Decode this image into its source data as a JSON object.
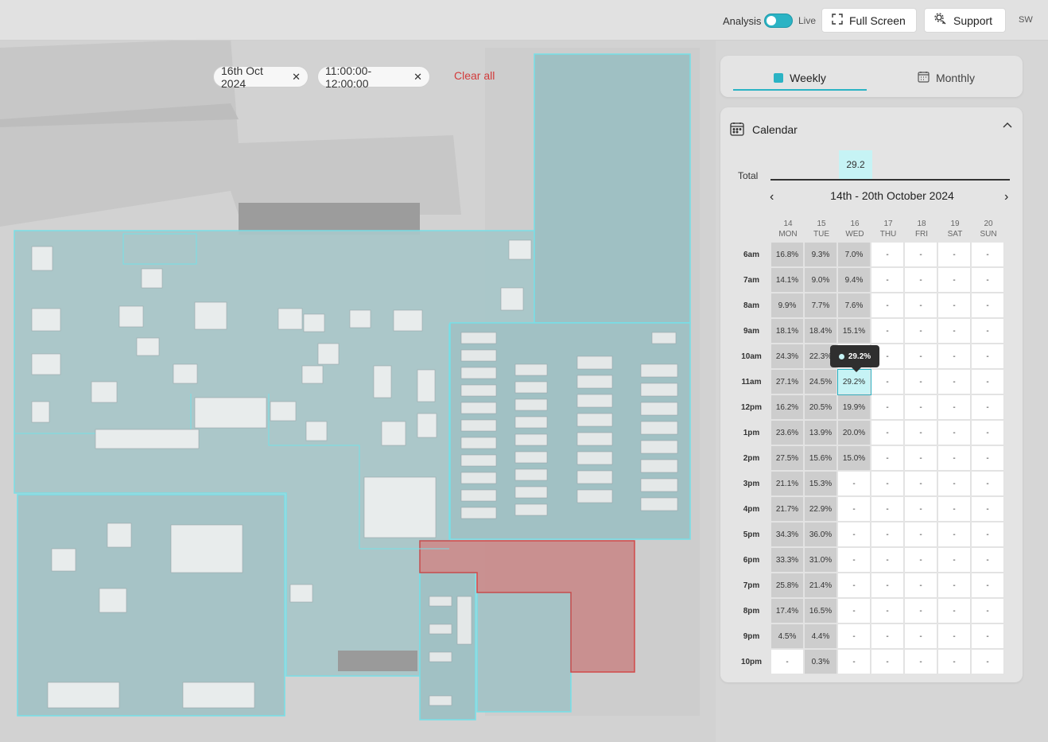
{
  "topbar": {
    "analysis_label": "Analysis",
    "live_label": "Live",
    "fullscreen_label": "Full Screen",
    "support_label": "Support",
    "user_initials": "SW",
    "toggle_state": "analysis"
  },
  "filters": {
    "chips": [
      "16th Oct 2024",
      "11:00:00-12:00:00"
    ],
    "clear_all_label": "Clear all"
  },
  "tabs": {
    "weekly_label": "Weekly",
    "monthly_label": "Monthly",
    "active": "weekly"
  },
  "calendar": {
    "title": "Calendar",
    "total_label": "Total",
    "total_value": "29.2",
    "week_range": "14th - 20th October 2024",
    "days": [
      {
        "num": "14",
        "name": "MON"
      },
      {
        "num": "15",
        "name": "TUE"
      },
      {
        "num": "16",
        "name": "WED"
      },
      {
        "num": "17",
        "name": "THU"
      },
      {
        "num": "18",
        "name": "FRI"
      },
      {
        "num": "19",
        "name": "SAT"
      },
      {
        "num": "20",
        "name": "SUN"
      }
    ],
    "hours": [
      "6am",
      "7am",
      "8am",
      "9am",
      "10am",
      "11am",
      "12pm",
      "1pm",
      "2pm",
      "3pm",
      "4pm",
      "5pm",
      "6pm",
      "7pm",
      "8pm",
      "9pm",
      "10pm"
    ],
    "rows": [
      [
        "16.8%",
        "9.3%",
        "7.0%",
        "-",
        "-",
        "-",
        "-"
      ],
      [
        "14.1%",
        "9.0%",
        "9.4%",
        "-",
        "-",
        "-",
        "-"
      ],
      [
        "9.9%",
        "7.7%",
        "7.6%",
        "-",
        "-",
        "-",
        "-"
      ],
      [
        "18.1%",
        "18.4%",
        "15.1%",
        "-",
        "-",
        "-",
        "-"
      ],
      [
        "24.3%",
        "22.3%",
        "",
        "-",
        "-",
        "-",
        "-"
      ],
      [
        "27.1%",
        "24.5%",
        "29.2%",
        "-",
        "-",
        "-",
        "-"
      ],
      [
        "16.2%",
        "20.5%",
        "19.9%",
        "-",
        "-",
        "-",
        "-"
      ],
      [
        "23.6%",
        "13.9%",
        "20.0%",
        "-",
        "-",
        "-",
        "-"
      ],
      [
        "27.5%",
        "15.6%",
        "15.0%",
        "-",
        "-",
        "-",
        "-"
      ],
      [
        "21.1%",
        "15.3%",
        "-",
        "-",
        "-",
        "-",
        "-"
      ],
      [
        "21.7%",
        "22.9%",
        "-",
        "-",
        "-",
        "-",
        "-"
      ],
      [
        "34.3%",
        "36.0%",
        "-",
        "-",
        "-",
        "-",
        "-"
      ],
      [
        "33.3%",
        "31.0%",
        "-",
        "-",
        "-",
        "-",
        "-"
      ],
      [
        "25.8%",
        "21.4%",
        "-",
        "-",
        "-",
        "-",
        "-"
      ],
      [
        "17.4%",
        "16.5%",
        "-",
        "-",
        "-",
        "-",
        "-"
      ],
      [
        "4.5%",
        "4.4%",
        "-",
        "-",
        "-",
        "-",
        "-"
      ],
      [
        "-",
        "0.3%",
        "-",
        "-",
        "-",
        "-",
        "-"
      ]
    ],
    "selected": {
      "row": 5,
      "col": 2
    },
    "tooltip_value": "29.2%",
    "colors": {
      "filled": "#cdcdcd",
      "empty": "#ffffff",
      "selected": "#c6f3f5",
      "accent": "#2bb3c4",
      "alert_zone": "#c98a8a"
    }
  }
}
